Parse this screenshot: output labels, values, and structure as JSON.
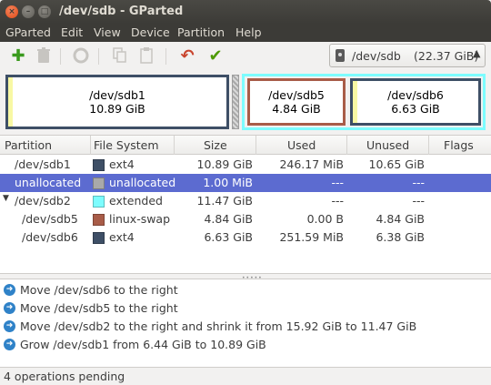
{
  "window": {
    "title": "/dev/sdb - GParted"
  },
  "menu": [
    "GParted",
    "Edit",
    "View",
    "Device",
    "Partition",
    "Help"
  ],
  "toolbar": {
    "new_icon": "new-partition-icon",
    "delete_icon": "delete-icon",
    "resize_icon": "resize-move-icon",
    "copy_icon": "copy-icon",
    "paste_icon": "paste-icon",
    "undo_icon": "undo-icon",
    "apply_icon": "apply-icon"
  },
  "device": {
    "name": "/dev/sdb",
    "size": "(22.37 GiB)"
  },
  "diskmap": {
    "sdb1": {
      "name": "/dev/sdb1",
      "size": "10.89 GiB",
      "used_fraction": 0.022,
      "border": "#3e4f66"
    },
    "sdb5": {
      "name": "/dev/sdb5",
      "size": "4.84 GiB",
      "used_fraction": 0.0,
      "border": "#a85c48"
    },
    "sdb6": {
      "name": "/dev/sdb6",
      "size": "6.63 GiB",
      "used_fraction": 0.038,
      "border": "#3e4f66"
    },
    "extended_border": "#7dfcfe"
  },
  "table": {
    "headers": [
      "Partition",
      "File System",
      "Size",
      "Used",
      "Unused",
      "Flags"
    ],
    "rows": [
      {
        "partition": "/dev/sdb1",
        "fs": "ext4",
        "fs_color": "#3e4f66",
        "size": "10.89 GiB",
        "used": "246.17 MiB",
        "unused": "10.65 GiB",
        "flags": ""
      },
      {
        "partition": "unallocated",
        "fs": "unallocated",
        "fs_color": "#a9a9a9",
        "size": "1.00 MiB",
        "used": "---",
        "unused": "---",
        "flags": ""
      },
      {
        "partition": "/dev/sdb2",
        "fs": "extended",
        "fs_color": "#7dfcfe",
        "size": "11.47 GiB",
        "used": "---",
        "unused": "---",
        "flags": ""
      },
      {
        "partition": "/dev/sdb5",
        "fs": "linux-swap",
        "fs_color": "#a85c48",
        "size": "4.84 GiB",
        "used": "0.00 B",
        "unused": "4.84 GiB",
        "flags": ""
      },
      {
        "partition": "/dev/sdb6",
        "fs": "ext4",
        "fs_color": "#3e4f66",
        "size": "6.63 GiB",
        "used": "251.59 MiB",
        "unused": "6.38 GiB",
        "flags": ""
      }
    ]
  },
  "operations": [
    "Move /dev/sdb6 to the right",
    "Move /dev/sdb5 to the right",
    "Move /dev/sdb2 to the right and shrink it from 15.92 GiB to 11.47 GiB",
    "Grow /dev/sdb1 from 6.44 GiB to 10.89 GiB"
  ],
  "status": "4 operations pending"
}
